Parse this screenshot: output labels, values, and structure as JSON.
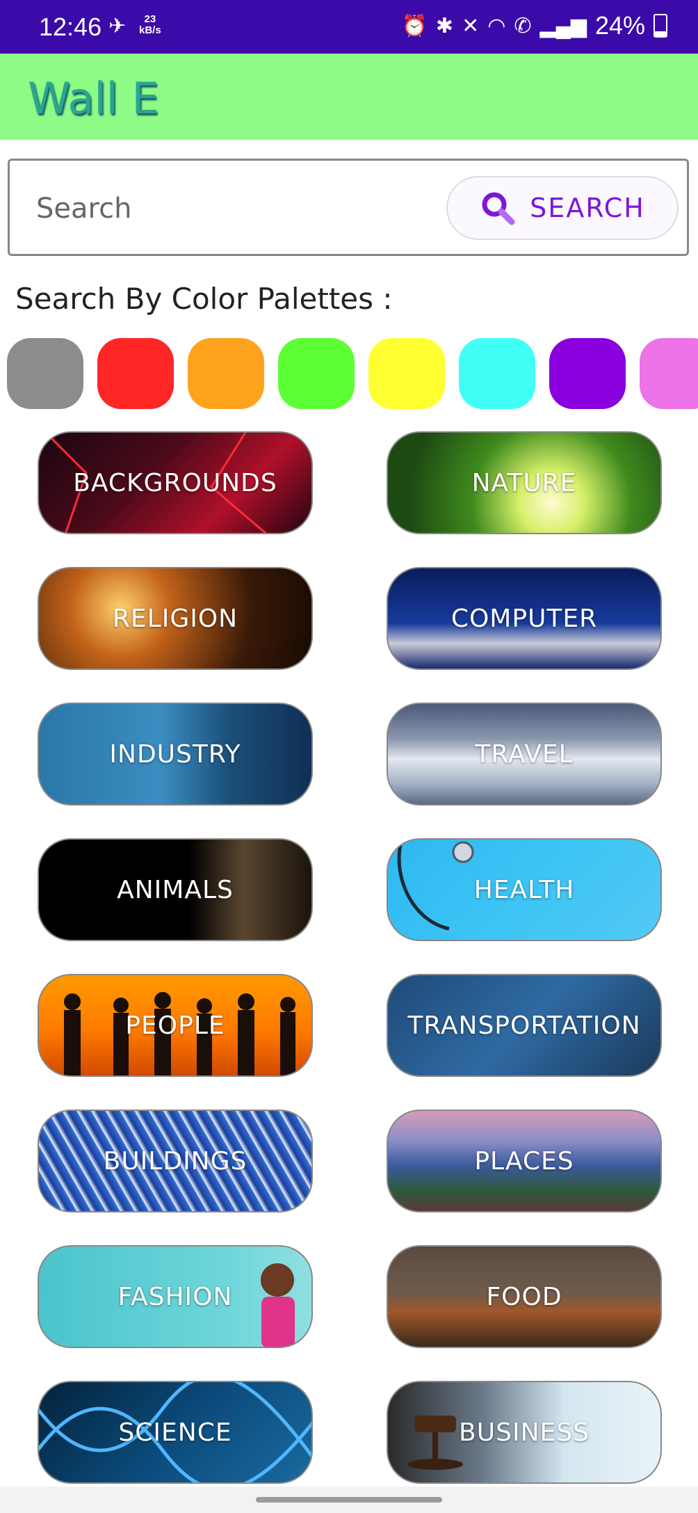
{
  "status_bar": {
    "time": "12:46",
    "net_rate_value": "23",
    "net_rate_unit": "kB/s",
    "battery": "24%",
    "icons": [
      "alarm-icon",
      "bluetooth-icon",
      "vibrate-off-icon",
      "wifi-icon",
      "wifi-calling-icon",
      "signal-icon",
      "battery-icon"
    ]
  },
  "app": {
    "title": "Wall E"
  },
  "search": {
    "placeholder": "Search",
    "button_label": "SEARCH",
    "accent": "#7b17d9"
  },
  "palette": {
    "title": "Search By Color Palettes :",
    "colors": [
      "#8c8c8c",
      "#ff2626",
      "#ffa31f",
      "#5cff34",
      "#ffff31",
      "#3ffff6",
      "#8a00de",
      "#ec73e8"
    ]
  },
  "categories": [
    {
      "label": "BACKGROUNDS"
    },
    {
      "label": "NATURE"
    },
    {
      "label": "RELIGION"
    },
    {
      "label": "COMPUTER"
    },
    {
      "label": "INDUSTRY"
    },
    {
      "label": "TRAVEL"
    },
    {
      "label": "ANIMALS"
    },
    {
      "label": "HEALTH"
    },
    {
      "label": "PEOPLE"
    },
    {
      "label": "TRANSPORTATION"
    },
    {
      "label": "BUILDINGS"
    },
    {
      "label": "PLACES"
    },
    {
      "label": "FASHION"
    },
    {
      "label": "FOOD"
    },
    {
      "label": "SCIENCE"
    },
    {
      "label": "BUSINESS"
    }
  ]
}
